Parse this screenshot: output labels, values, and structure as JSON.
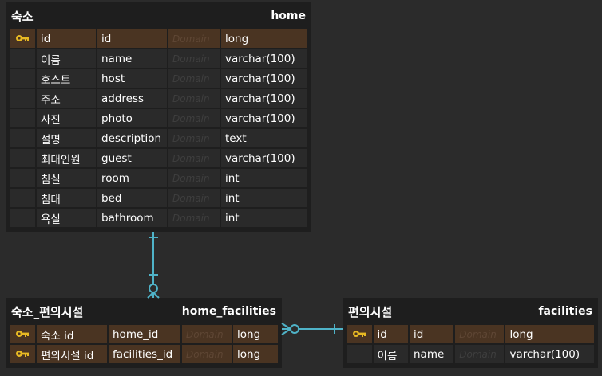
{
  "entities": {
    "home": {
      "title_ko": "숙소",
      "name": "home",
      "rows": [
        {
          "pk": true,
          "ko": "id",
          "col": "id",
          "domain": "Domain",
          "type": "long"
        },
        {
          "pk": false,
          "ko": "이름",
          "col": "name",
          "domain": "Domain",
          "type": "varchar(100)"
        },
        {
          "pk": false,
          "ko": "호스트",
          "col": "host",
          "domain": "Domain",
          "type": "varchar(100)"
        },
        {
          "pk": false,
          "ko": "주소",
          "col": "address",
          "domain": "Domain",
          "type": "varchar(100)"
        },
        {
          "pk": false,
          "ko": "사진",
          "col": "photo",
          "domain": "Domain",
          "type": "varchar(100)"
        },
        {
          "pk": false,
          "ko": "설명",
          "col": "description",
          "domain": "Domain",
          "type": "text"
        },
        {
          "pk": false,
          "ko": "최대인원",
          "col": "guest",
          "domain": "Domain",
          "type": "varchar(100)"
        },
        {
          "pk": false,
          "ko": "침실",
          "col": "room",
          "domain": "Domain",
          "type": "int"
        },
        {
          "pk": false,
          "ko": "침대",
          "col": "bed",
          "domain": "Domain",
          "type": "int"
        },
        {
          "pk": false,
          "ko": "욕실",
          "col": "bathroom",
          "domain": "Domain",
          "type": "int"
        }
      ]
    },
    "home_facilities": {
      "title_ko": "숙소_편의시설",
      "name": "home_facilities",
      "rows": [
        {
          "pk": true,
          "ko": "숙소 id",
          "col": "home_id",
          "domain": "Domain",
          "type": "long"
        },
        {
          "pk": true,
          "ko": "편의시설 id",
          "col": "facilities_id",
          "domain": "Domain",
          "type": "long"
        }
      ]
    },
    "facilities": {
      "title_ko": "편의시설",
      "name": "facilities",
      "rows": [
        {
          "pk": true,
          "ko": "id",
          "col": "id",
          "domain": "Domain",
          "type": "long"
        },
        {
          "pk": false,
          "ko": "이름",
          "col": "name",
          "domain": "Domain",
          "type": "varchar(100)"
        }
      ]
    }
  },
  "colors": {
    "background": "#2b2b2b",
    "entity": "#1e1e1e",
    "cell": "#2a2a2a",
    "pk_cell": "#4a3422",
    "key_icon": "#e8b923",
    "relation_line": "#4fb3c8"
  },
  "icons": {
    "primary_key": "key-icon"
  }
}
